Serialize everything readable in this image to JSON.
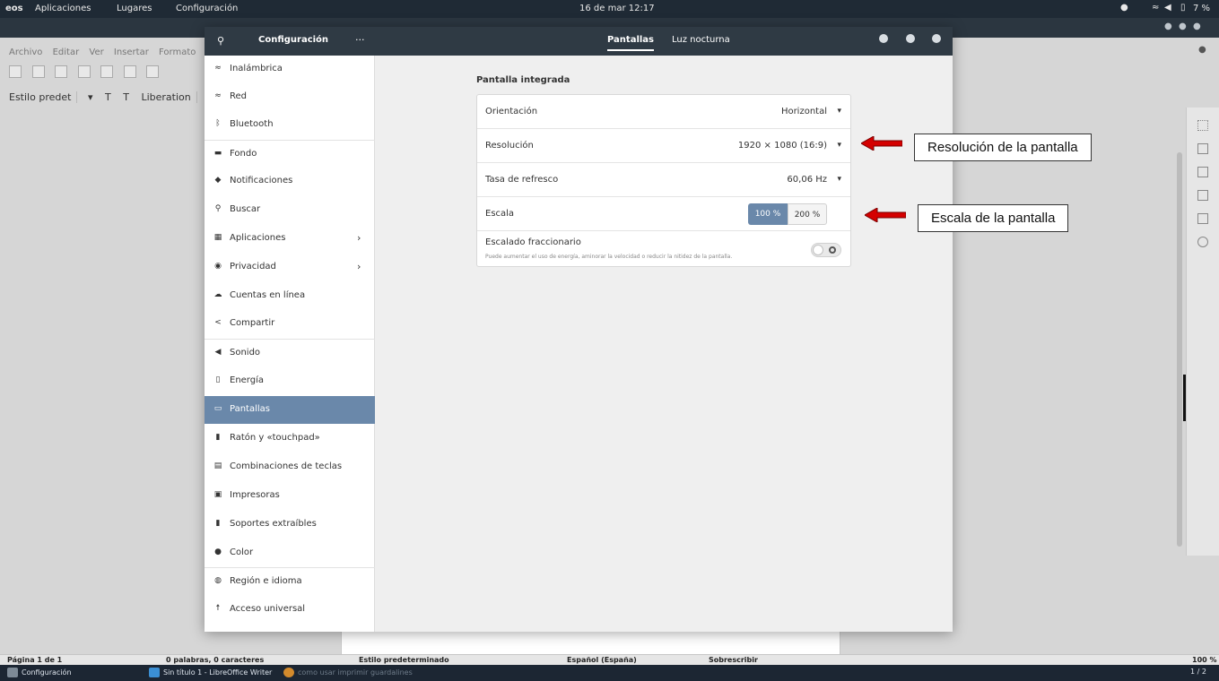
{
  "topbar": {
    "logo": "eos",
    "menu": [
      "Aplicaciones",
      "Lugares",
      "Configuración"
    ],
    "clock": "16 de mar  12:17",
    "battery": "7 %"
  },
  "writer": {
    "menus": [
      "Archivo",
      "Editar",
      "Ver",
      "Insertar",
      "Formato"
    ],
    "paragraph_style": "Estilo predet",
    "font_name": "Liberation"
  },
  "statusbar": {
    "page": "Página 1 de 1",
    "words": "0 palabras, 0 caracteres",
    "style": "Estilo predeterminado",
    "language": "Español (España)",
    "mode": "Sobrescribir",
    "zoom": "100 %"
  },
  "taskbar": {
    "tasks": [
      "Configuración",
      "Sin título 1 - LibreOffice Writer",
      "como usar imprimir guardalines"
    ],
    "pages": "1 / 2"
  },
  "settings": {
    "header": {
      "title": "Configuración",
      "tabs": [
        "Pantallas",
        "Luz nocturna"
      ]
    },
    "sidebar": [
      {
        "icon": "wifi",
        "label": "Inalámbrica"
      },
      {
        "icon": "wifi",
        "label": "Red"
      },
      {
        "icon": "bluetooth",
        "label": "Bluetooth"
      },
      {
        "icon": "background",
        "label": "Fondo"
      },
      {
        "icon": "bell",
        "label": "Notificaciones"
      },
      {
        "icon": "search",
        "label": "Buscar"
      },
      {
        "icon": "grid",
        "label": "Aplicaciones"
      },
      {
        "icon": "privacy",
        "label": "Privacidad"
      },
      {
        "icon": "cloud",
        "label": "Cuentas en línea"
      },
      {
        "icon": "share",
        "label": "Compartir"
      },
      {
        "icon": "speaker",
        "label": "Sonido"
      },
      {
        "icon": "power",
        "label": "Energía"
      },
      {
        "icon": "display",
        "label": "Pantallas"
      },
      {
        "icon": "mouse",
        "label": "Ratón y «touchpad»"
      },
      {
        "icon": "keyboard",
        "label": "Combinaciones de teclas"
      },
      {
        "icon": "printer",
        "label": "Impresoras"
      },
      {
        "icon": "usb",
        "label": "Soportes extraíbles"
      },
      {
        "icon": "color",
        "label": "Color"
      },
      {
        "icon": "globe",
        "label": "Región e idioma"
      },
      {
        "icon": "accessibility",
        "label": "Acceso universal"
      }
    ],
    "display": {
      "section_title": "Pantalla integrada",
      "orientation_label": "Orientación",
      "orientation_value": "Horizontal",
      "resolution_label": "Resolución",
      "resolution_value": "1920 × 1080 (16:9)",
      "refresh_label": "Tasa de refresco",
      "refresh_value": "60,06 Hz",
      "scale_label": "Escala",
      "scale_options": [
        "100 %",
        "200 %"
      ],
      "fractional_label": "Escalado fraccionario",
      "fractional_desc": "Puede aumentar el uso de energía, aminorar la velocidad o reducir la nitidez de la pantalla."
    }
  },
  "annotations": {
    "resolution_note": "Resolución de la pantalla",
    "scale_note": "Escala de la pantalla",
    "arrow_color": "#d40000"
  }
}
